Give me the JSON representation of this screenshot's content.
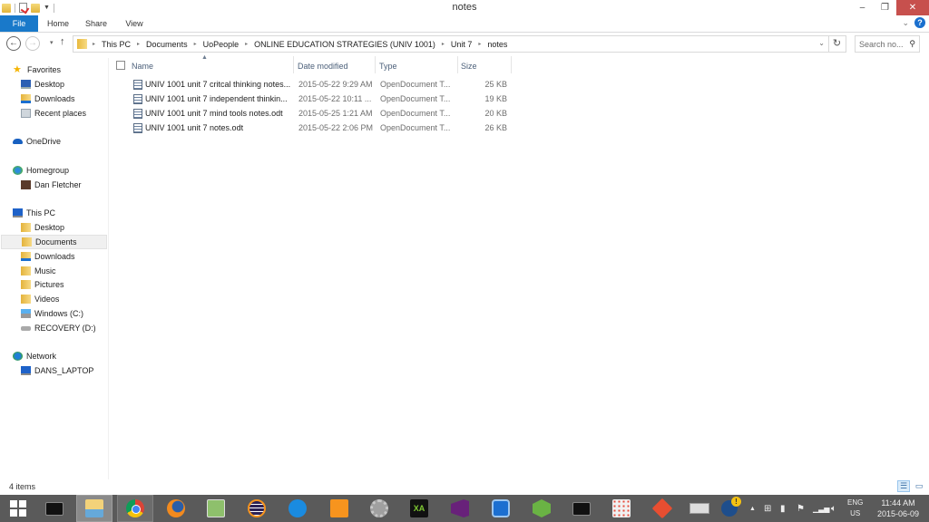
{
  "window": {
    "title": "notes",
    "controls": {
      "minimize": "–",
      "restore": "❐",
      "close": "✕"
    }
  },
  "ribbon": {
    "tabs": [
      {
        "label": "File",
        "active": true
      },
      {
        "label": "Home"
      },
      {
        "label": "Share"
      },
      {
        "label": "View"
      }
    ],
    "expand_glyph": "⌄",
    "help_glyph": "?"
  },
  "address": {
    "back_glyph": "←",
    "forward_glyph": "→",
    "recent_glyph": "▾",
    "up_glyph": "↑",
    "crumbs": [
      "This PC",
      "Documents",
      "UoPeople",
      "ONLINE EDUCATION STRATEGIES (UNIV 1001)",
      "Unit 7",
      "notes"
    ],
    "crumb_sep": "▸",
    "dropdown_glyph": "⌄",
    "refresh_glyph": "↻",
    "search_placeholder": "Search no...",
    "search_glyph": "⚲"
  },
  "nav_pane": {
    "items": [
      {
        "label": "Favorites",
        "icon": "star-icon",
        "level": 0
      },
      {
        "label": "Desktop",
        "icon": "desktop-icon",
        "level": 1
      },
      {
        "label": "Downloads",
        "icon": "downloads-icon",
        "level": 1
      },
      {
        "label": "Recent places",
        "icon": "recent-places-icon",
        "level": 1
      },
      {
        "label": "OneDrive",
        "icon": "onedrive-icon",
        "level": 0
      },
      {
        "label": "Homegroup",
        "icon": "homegroup-icon",
        "level": 0
      },
      {
        "label": "Dan Fletcher",
        "icon": "user-icon",
        "level": 1
      },
      {
        "label": "This PC",
        "icon": "computer-icon",
        "level": 0
      },
      {
        "label": "Desktop",
        "icon": "desktop-folder-icon",
        "level": 1
      },
      {
        "label": "Documents",
        "icon": "documents-icon",
        "level": 1,
        "selected": true
      },
      {
        "label": "Downloads",
        "icon": "downloads-icon",
        "level": 1
      },
      {
        "label": "Music",
        "icon": "music-icon",
        "level": 1
      },
      {
        "label": "Pictures",
        "icon": "pictures-icon",
        "level": 1
      },
      {
        "label": "Videos",
        "icon": "videos-icon",
        "level": 1
      },
      {
        "label": "Windows (C:)",
        "icon": "drive-c-icon",
        "level": 1
      },
      {
        "label": "RECOVERY (D:)",
        "icon": "drive-d-icon",
        "level": 1
      },
      {
        "label": "Network",
        "icon": "network-icon",
        "level": 0
      },
      {
        "label": "DANS_LAPTOP",
        "icon": "computer-icon",
        "level": 1
      }
    ]
  },
  "file_list": {
    "columns": [
      "Name",
      "Date modified",
      "Type",
      "Size"
    ],
    "sort_glyph": "▲",
    "files": [
      {
        "name": "UNIV 1001 unit 7 critcal thinking notes...",
        "date": "2015-05-22 9:29 AM",
        "type": "OpenDocument T...",
        "size": "25 KB"
      },
      {
        "name": "UNIV 1001 unit 7 independent thinkin...",
        "date": "2015-05-22 10:11 ...",
        "type": "OpenDocument T...",
        "size": "19 KB"
      },
      {
        "name": "UNIV 1001 unit 7 mind tools notes.odt",
        "date": "2015-05-25 1:21 AM",
        "type": "OpenDocument T...",
        "size": "20 KB"
      },
      {
        "name": "UNIV 1001 unit 7 notes.odt",
        "date": "2015-05-22 2:06 PM",
        "type": "OpenDocument T...",
        "size": "26 KB"
      }
    ]
  },
  "status": {
    "item_count": "4 items",
    "details_view_glyph": "☰",
    "large_icons_glyph": "▭"
  },
  "taskbar": {
    "apps": [
      {
        "name": "start",
        "state": "none"
      },
      {
        "name": "command-prompt",
        "state": "none"
      },
      {
        "name": "file-explorer",
        "state": "active"
      },
      {
        "name": "chrome",
        "state": "open"
      },
      {
        "name": "firefox",
        "state": "none"
      },
      {
        "name": "notepad-plus-plus",
        "state": "none"
      },
      {
        "name": "eclipse",
        "state": "none"
      },
      {
        "name": "virtualbox",
        "state": "none"
      },
      {
        "name": "sublime-pencil",
        "state": "none"
      },
      {
        "name": "settings-gear",
        "state": "none"
      },
      {
        "name": "vox",
        "state": "none"
      },
      {
        "name": "visual-studio",
        "state": "none"
      },
      {
        "name": "teamviewer",
        "state": "none"
      },
      {
        "name": "android-studio",
        "state": "none"
      },
      {
        "name": "command-prompt-2",
        "state": "none"
      },
      {
        "name": "metro-apps",
        "state": "none"
      },
      {
        "name": "git",
        "state": "none"
      }
    ],
    "tray": {
      "show_hidden_glyph": "▲",
      "language_top": "ENG",
      "language_bottom": "US",
      "time": "11:44 AM",
      "date": "2015-06-09"
    }
  }
}
